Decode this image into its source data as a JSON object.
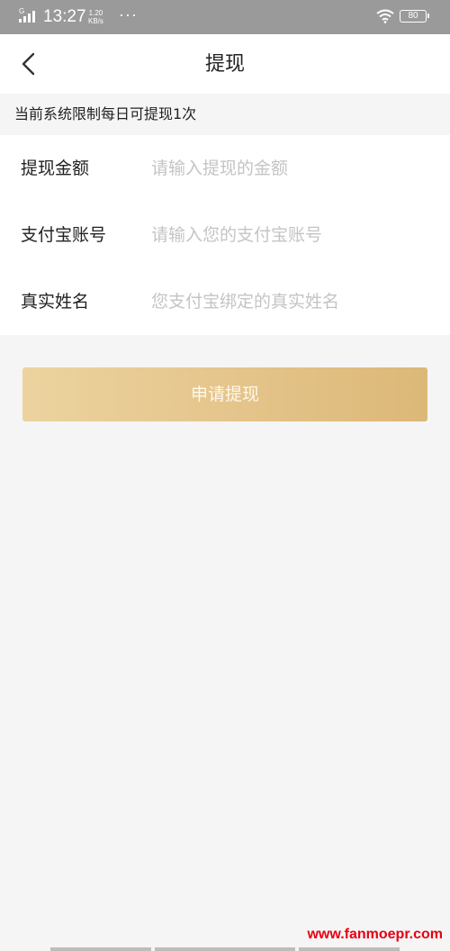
{
  "status_bar": {
    "network": "G",
    "time": "13:27",
    "speed_value": "1.20",
    "speed_unit": "KB/s",
    "more": "···",
    "battery": "80",
    "icons": [
      "signal-icon",
      "wifi-icon",
      "battery-icon"
    ]
  },
  "nav": {
    "title": "提现",
    "back_icon": "chevron-left-icon"
  },
  "notice": {
    "text": "当前系统限制每日可提现1次"
  },
  "form": {
    "rows": [
      {
        "label": "提现金额",
        "value": "",
        "placeholder": "请输入提现的金额"
      },
      {
        "label": "支付宝账号",
        "value": "",
        "placeholder": "请输入您的支付宝账号"
      },
      {
        "label": "真实姓名",
        "value": "",
        "placeholder": "您支付宝绑定的真实姓名"
      }
    ]
  },
  "submit": {
    "label": "申请提现"
  },
  "watermark": {
    "text": "www.fanmoepr.com"
  },
  "colors": {
    "status_bar": "#9a9a9a",
    "background": "#f5f5f5",
    "button_gold": "#e4c48a",
    "placeholder": "#c4c4c4",
    "watermark": "#e60012"
  }
}
